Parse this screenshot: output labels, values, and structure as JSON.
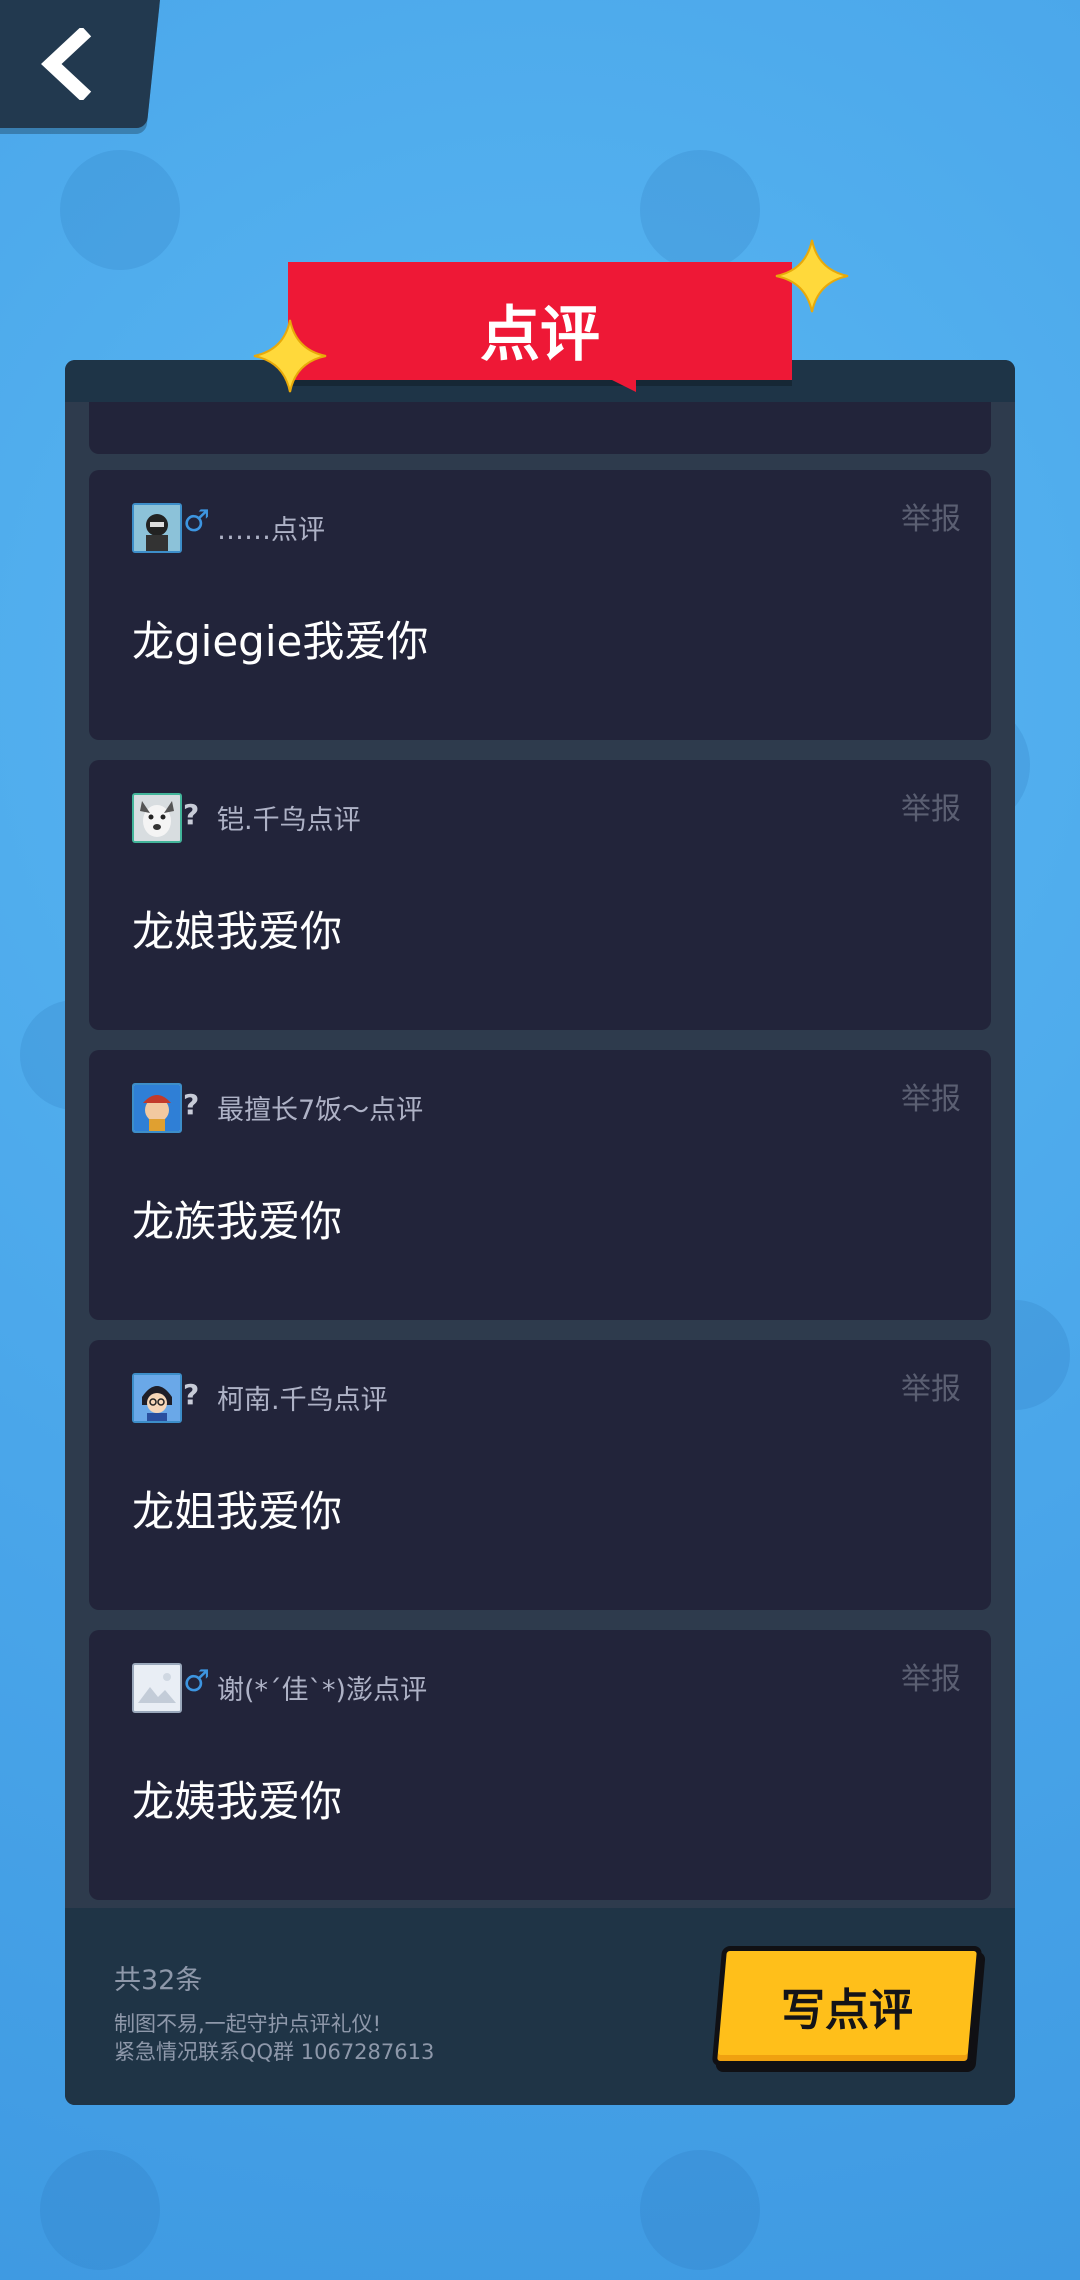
{
  "title": "点评",
  "reviews": [
    {
      "gender_icon": "♂",
      "reviewer": "……点评",
      "comment": "龙giegie我爱你",
      "report_label": "举报"
    },
    {
      "gender_icon": "?",
      "reviewer": "铠.千鸟点评",
      "comment": "龙娘我爱你",
      "report_label": "举报"
    },
    {
      "gender_icon": "?",
      "reviewer": "最擅长7饭～点评",
      "comment": "龙族我爱你",
      "report_label": "举报"
    },
    {
      "gender_icon": "?",
      "reviewer": "柯南.千鸟点评",
      "comment": "龙姐我爱你",
      "report_label": "举报"
    },
    {
      "gender_icon": "♂",
      "reviewer": "谢(*´佳`*)澎点评",
      "comment": "龙姨我爱你",
      "report_label": "举报"
    }
  ],
  "footer": {
    "count": "共32条",
    "notice_line1": "制图不易,一起守护点评礼仪!",
    "notice_line2": "紧急情况联系QQ群 1067287613",
    "write_button": "写点评"
  }
}
